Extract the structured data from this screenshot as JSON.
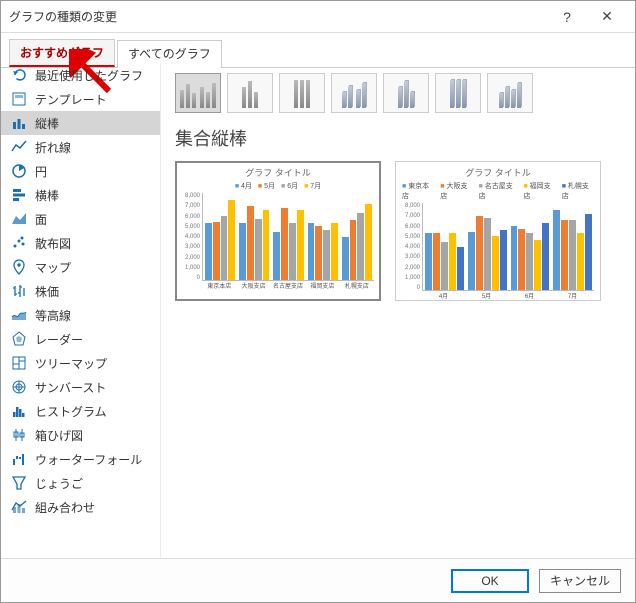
{
  "window": {
    "title": "グラフの種類の変更",
    "help_label": "?",
    "close_label": "✕"
  },
  "tabs": {
    "recommended": "おすすめグラフ",
    "all": "すべてのグラフ"
  },
  "sidebar": {
    "items": [
      {
        "id": "recent",
        "label": "最近使用したグラフ",
        "icon": "undo"
      },
      {
        "id": "template",
        "label": "テンプレート",
        "icon": "template"
      },
      {
        "id": "column",
        "label": "縦棒",
        "icon": "column",
        "selected": true
      },
      {
        "id": "line",
        "label": "折れ線",
        "icon": "line"
      },
      {
        "id": "pie",
        "label": "円",
        "icon": "pie"
      },
      {
        "id": "bar",
        "label": "横棒",
        "icon": "bar"
      },
      {
        "id": "area",
        "label": "面",
        "icon": "area"
      },
      {
        "id": "scatter",
        "label": "散布図",
        "icon": "scatter"
      },
      {
        "id": "map",
        "label": "マップ",
        "icon": "map"
      },
      {
        "id": "stock",
        "label": "株価",
        "icon": "stock"
      },
      {
        "id": "surface",
        "label": "等高線",
        "icon": "surface"
      },
      {
        "id": "radar",
        "label": "レーダー",
        "icon": "radar"
      },
      {
        "id": "treemap",
        "label": "ツリーマップ",
        "icon": "treemap"
      },
      {
        "id": "sunburst",
        "label": "サンバースト",
        "icon": "sunburst"
      },
      {
        "id": "histogram",
        "label": "ヒストグラム",
        "icon": "histogram"
      },
      {
        "id": "boxplot",
        "label": "箱ひげ図",
        "icon": "boxplot"
      },
      {
        "id": "waterfall",
        "label": "ウォーターフォール",
        "icon": "waterfall"
      },
      {
        "id": "funnel",
        "label": "じょうご",
        "icon": "funnel"
      },
      {
        "id": "combo",
        "label": "組み合わせ",
        "icon": "combo"
      }
    ]
  },
  "main": {
    "chart_type_title": "集合縦棒"
  },
  "preview": {
    "title": "グラフ タイトル",
    "ymax": 8000,
    "ticks": [
      "8,000",
      "7,000",
      "6,000",
      "5,000",
      "4,000",
      "3,000",
      "2,000",
      "1,000",
      "0"
    ],
    "legend_by_store": [
      "4月",
      "5月",
      "6月",
      "7月"
    ],
    "categories_by_store": [
      "東京本店",
      "大阪支店",
      "名古屋支店",
      "福岡支店",
      "札幌支店"
    ],
    "legend_by_month": [
      "東京本店",
      "大阪支店",
      "名古屋支店",
      "福岡支店",
      "札幌支店"
    ],
    "categories_by_month": [
      "4月",
      "5月",
      "6月",
      "7月"
    ]
  },
  "buttons": {
    "ok": "OK",
    "cancel": "キャンセル"
  },
  "colors": {
    "series": [
      "#5b9bd5",
      "#ed7d31",
      "#a5a5a5",
      "#ffc000",
      "#4472c4"
    ]
  },
  "chart_data": [
    {
      "type": "bar",
      "title": "グラフ タイトル",
      "orientation": "grouped-by-store",
      "ylabel": "",
      "ylim": [
        0,
        8000
      ],
      "categories": [
        "東京本店",
        "大阪支店",
        "名古屋支店",
        "福岡支店",
        "札幌支店"
      ],
      "series": [
        {
          "name": "4月",
          "values": [
            5200,
            5200,
            4400,
            5200,
            4000
          ]
        },
        {
          "name": "5月",
          "values": [
            5300,
            6800,
            6600,
            5000,
            5500
          ]
        },
        {
          "name": "6月",
          "values": [
            5900,
            5600,
            5200,
            4600,
            6200
          ]
        },
        {
          "name": "7月",
          "values": [
            7400,
            6400,
            6400,
            5200,
            7000
          ]
        }
      ]
    },
    {
      "type": "bar",
      "title": "グラフ タイトル",
      "orientation": "grouped-by-month",
      "ylabel": "",
      "ylim": [
        0,
        8000
      ],
      "categories": [
        "4月",
        "5月",
        "6月",
        "7月"
      ],
      "series": [
        {
          "name": "東京本店",
          "values": [
            5200,
            5300,
            5900,
            7400
          ]
        },
        {
          "name": "大阪支店",
          "values": [
            5200,
            6800,
            5600,
            6400
          ]
        },
        {
          "name": "名古屋支店",
          "values": [
            4400,
            6600,
            5200,
            6400
          ]
        },
        {
          "name": "福岡支店",
          "values": [
            5200,
            5000,
            4600,
            5200
          ]
        },
        {
          "name": "札幌支店",
          "values": [
            4000,
            5500,
            6200,
            7000
          ]
        }
      ]
    }
  ]
}
